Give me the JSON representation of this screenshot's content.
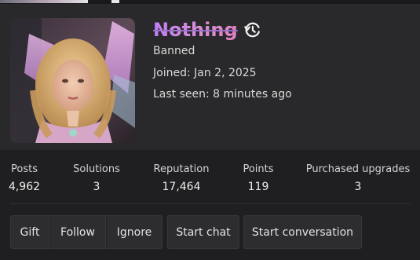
{
  "profile": {
    "username": "Nothing",
    "status": "Banned",
    "joined": "Joined: Jan 2, 2025",
    "last_seen": "Last seen: 8 minutes ago",
    "avatar_icon": "user-avatar-photo",
    "history_icon": "history-icon",
    "username_color": "#bb90ee"
  },
  "stats": [
    {
      "label": "Posts",
      "value": "4,962"
    },
    {
      "label": "Solutions",
      "value": "3"
    },
    {
      "label": "Reputation",
      "value": "17,464"
    },
    {
      "label": "Points",
      "value": "119"
    },
    {
      "label": "Purchased upgrades",
      "value": "3"
    }
  ],
  "actions": {
    "gift": "Gift",
    "follow": "Follow",
    "ignore": "Ignore",
    "start_chat": "Start chat",
    "start_conversation": "Start conversation"
  }
}
